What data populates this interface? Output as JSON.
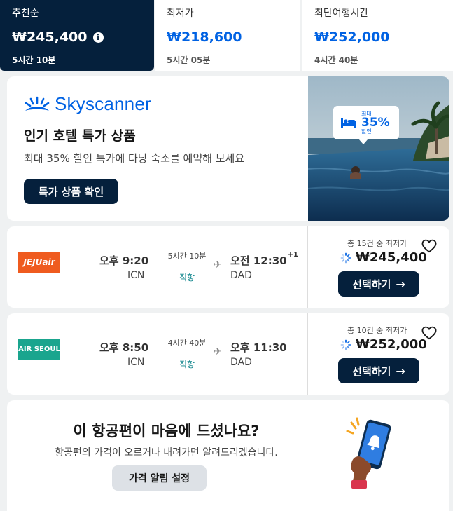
{
  "sort_tabs": [
    {
      "label": "추천순",
      "price": "₩245,400",
      "duration": "5시간 10분",
      "active": true
    },
    {
      "label": "최저가",
      "price": "₩218,600",
      "duration": "5시간 05분",
      "active": false
    },
    {
      "label": "최단여행시간",
      "price": "₩252,000",
      "duration": "4시간 40분",
      "active": false
    }
  ],
  "ad": {
    "brand": "Skyscanner",
    "title": "인기 호텔 특가 상품",
    "subtitle": "최대 35% 할인 특가에 다낭 숙소를 예약해 보세요",
    "button_label": "특가 상품 확인",
    "badge_top": "최대",
    "badge_big": "35%",
    "badge_bottom": "할인"
  },
  "flights": [
    {
      "airline": "JEJUair",
      "dep_time": "오후 9:20",
      "dep_code": "ICN",
      "duration": "5시간 10분",
      "stops": "직항",
      "arr_time": "오전 12:30",
      "arr_day_offset": "+1",
      "arr_code": "DAD",
      "cheapest_note": "총 15건 중 최저가",
      "price": "₩245,400",
      "select_label": "선택하기"
    },
    {
      "airline": "AIR SEOUL",
      "dep_time": "오후 8:50",
      "dep_code": "ICN",
      "duration": "4시간 40분",
      "stops": "직항",
      "arr_time": "오후 11:30",
      "arr_day_offset": "",
      "arr_code": "DAD",
      "cheapest_note": "총 10건 중 최저가",
      "price": "₩252,000",
      "select_label": "선택하기"
    }
  ],
  "alert": {
    "title": "이 항공편이 마음에 드셨나요?",
    "subtitle": "항공편의 가격이 오르거나 내려가면 알려드리겠습니다.",
    "button_label": "가격 알림 설정"
  },
  "colors": {
    "navy": "#05203c",
    "brand_blue": "#0062e3",
    "teal": "#0c838a",
    "jeju_orange": "#ef5b1f",
    "air_seoul_green": "#1aa58e"
  }
}
